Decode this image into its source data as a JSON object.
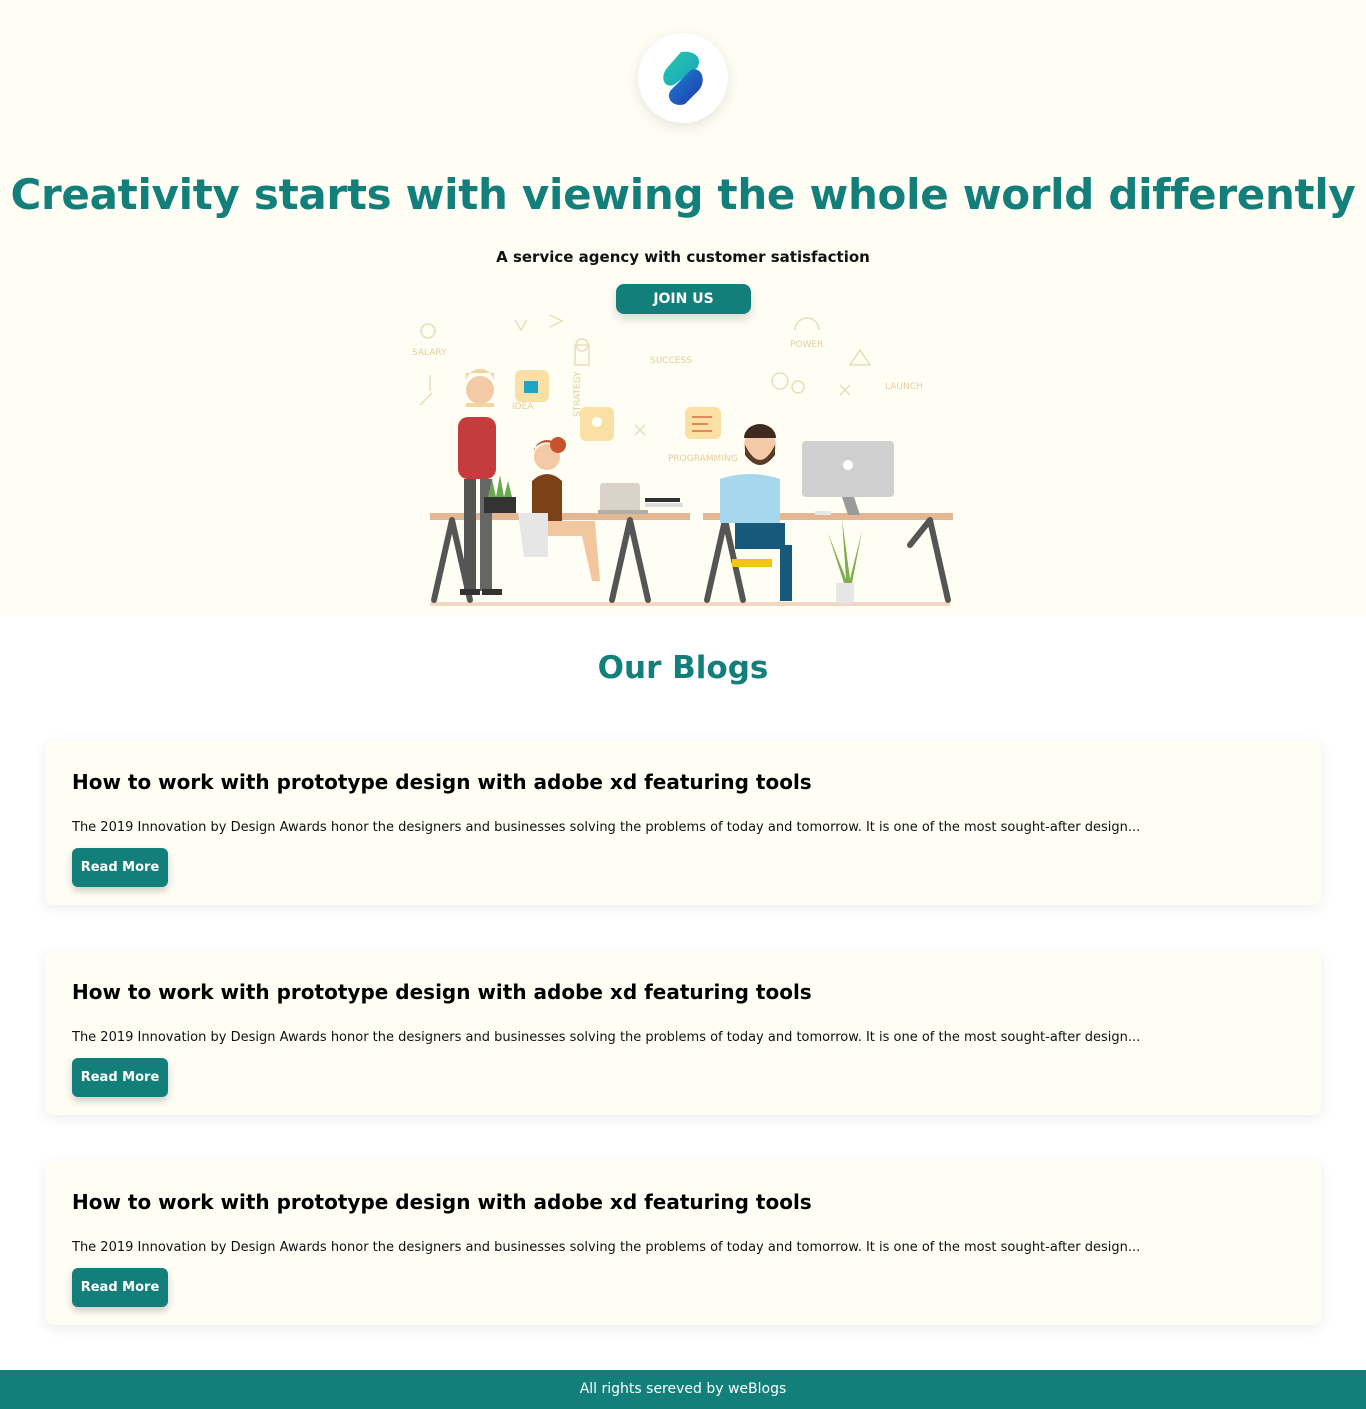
{
  "hero": {
    "logo_icon": "brand-s-logo-icon",
    "title": "Creativity starts with viewing the whole world differently",
    "subtitle": "A service agency with customer satisfaction",
    "join_label": "JOIN US",
    "illustration_words": [
      "SALARY",
      "SUCCESS",
      "POWER",
      "LAUNCH",
      "STRATEGY",
      "IDEA",
      "PROGRAMMING"
    ]
  },
  "blogs": {
    "heading": "Our Blogs",
    "items": [
      {
        "title": "How to work with prototype design with adobe xd featuring tools",
        "excerpt": "The 2019 Innovation by Design Awards honor the designers and businesses solving the problems of today and tomorrow. It is one of the most sought-after design...",
        "read_more_label": "Read More"
      },
      {
        "title": "How to work with prototype design with adobe xd featuring tools",
        "excerpt": "The 2019 Innovation by Design Awards honor the designers and businesses solving the problems of today and tomorrow. It is one of the most sought-after design...",
        "read_more_label": "Read More"
      },
      {
        "title": "How to work with prototype design with adobe xd featuring tools",
        "excerpt": "The 2019 Innovation by Design Awards honor the designers and businesses solving the problems of today and tomorrow. It is one of the most sought-after design...",
        "read_more_label": "Read More"
      }
    ]
  },
  "footer": {
    "text": "All rights sereved by weBlogs"
  },
  "colors": {
    "brand": "#127f7b",
    "hero_bg": "#fefef5",
    "card_bg": "#fefef5"
  }
}
